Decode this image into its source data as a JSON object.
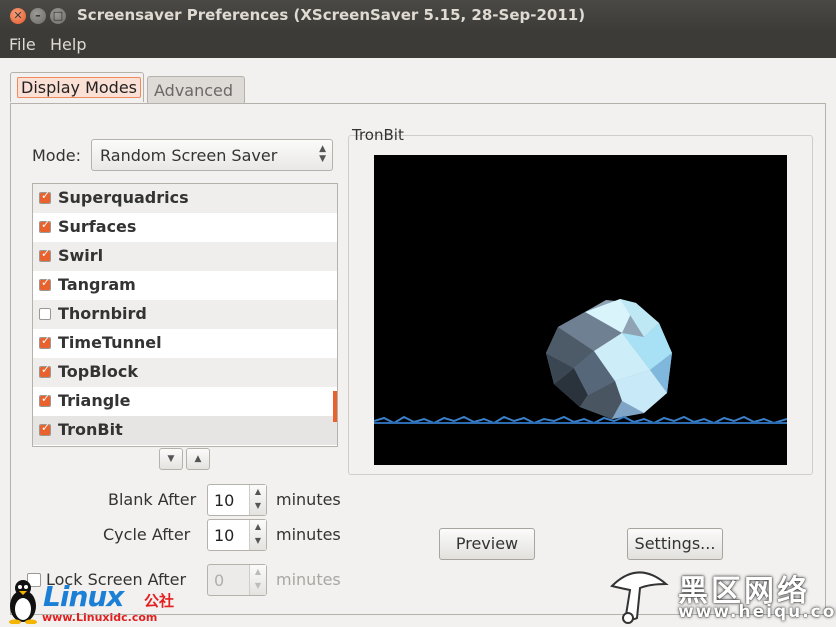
{
  "window": {
    "title": "Screensaver Preferences  (XScreenSaver 5.15, 28-Sep-2011)"
  },
  "menu": [
    "File",
    "Help"
  ],
  "tabs": [
    {
      "label": "Display Modes",
      "active": true
    },
    {
      "label": "Advanced",
      "active": false
    }
  ],
  "mode": {
    "label": "Mode:",
    "value": "Random Screen Saver"
  },
  "savers": [
    {
      "name": "Superquadrics",
      "checked": true
    },
    {
      "name": "Surfaces",
      "checked": true
    },
    {
      "name": "Swirl",
      "checked": true
    },
    {
      "name": "Tangram",
      "checked": true
    },
    {
      "name": "Thornbird",
      "checked": false
    },
    {
      "name": "TimeTunnel",
      "checked": true
    },
    {
      "name": "TopBlock",
      "checked": true
    },
    {
      "name": "Triangle",
      "checked": true
    },
    {
      "name": "TronBit",
      "checked": true,
      "selected": true
    }
  ],
  "preview": {
    "frame_label": "TronBit",
    "preview_button": "Preview",
    "settings_button": "Settings..."
  },
  "timing": {
    "blank_label": "Blank After",
    "blank_value": "10",
    "cycle_label": "Cycle After",
    "cycle_value": "10",
    "lock_label": "Lock Screen After",
    "lock_value": "0",
    "unit": "minutes"
  },
  "watermarks": {
    "left_logo": "Linux",
    "left_logo_suffix": "公社",
    "left_url": "www.Linuxidc.com",
    "right_brand": "黑区网络",
    "right_site": "www.heiqu.com"
  },
  "colors": {
    "accent": "#e9622e",
    "titlebar": "#3c3b37"
  }
}
